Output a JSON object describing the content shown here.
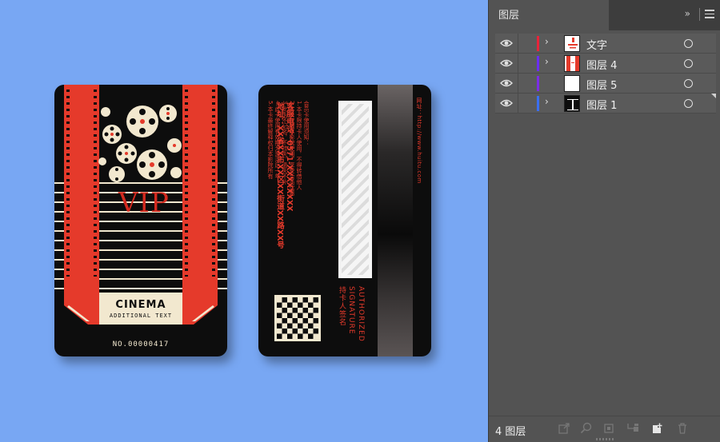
{
  "artboard": {
    "front": {
      "vip": "VIP",
      "cinema": "CINEMA",
      "additional": "ADDITIONAL TEXT",
      "card_no": "NO.00000417"
    },
    "back": {
      "rules": [
        "会员卡使用须知：",
        "1.本卡限持卡人使用，不得转借他人",
        "2.本卡仅限本影院使用，享受会员优惠",
        "3.此卡不记名，不挂失，遗失不补",
        "4.此卡使用有效期为激活后一年",
        "5.本卡最终解释权归本影院所有"
      ],
      "hotline": [
        "客服电话：0571-XXXXXXXX",
        "地址：XX省XX市XX区XX街道XX路XX号"
      ],
      "website": "网址：http://www.huitu.com",
      "authorized": [
        "AUTHORIZED",
        "SIGNATURE",
        "持卡人签名"
      ]
    }
  },
  "panel": {
    "tab_title": "图层",
    "collapse_glyph": "»",
    "layers": [
      {
        "name": "文字",
        "color": "#e8243a",
        "expandable": true,
        "thumb": "text"
      },
      {
        "name": "图层 4",
        "color": "#6a2ef0",
        "expandable": true,
        "thumb": "strips"
      },
      {
        "name": "图层 5",
        "color": "#7a2ee6",
        "expandable": false,
        "thumb": "white"
      },
      {
        "name": "图层 1",
        "color": "#3b6ef0",
        "expandable": true,
        "thumb": "black"
      }
    ],
    "footer": {
      "count": "4 图层"
    }
  },
  "colors": {
    "background": "#78a7f3",
    "card_black": "#0d0d0d",
    "film_red": "#e53a2b",
    "cream": "#f2e8cf",
    "panel_bg": "#535353"
  }
}
